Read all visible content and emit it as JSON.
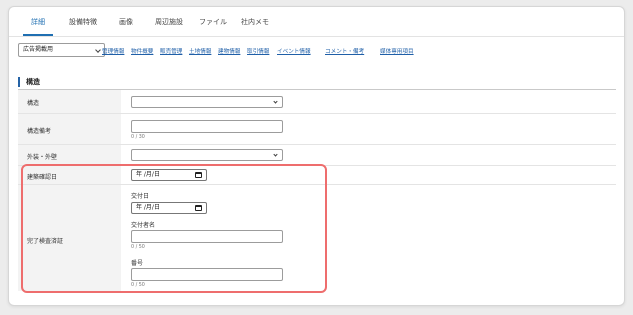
{
  "tabs": [
    {
      "label": "詳細",
      "active": true
    },
    {
      "label": "設備特徴",
      "active": false
    },
    {
      "label": "画像",
      "active": false
    },
    {
      "label": "周辺施設",
      "active": false
    },
    {
      "label": "ファイル",
      "active": false
    },
    {
      "label": "社内メモ",
      "active": false
    }
  ],
  "ad_select": {
    "value": "広告掲載用"
  },
  "jump_links": [
    "管理情報",
    "物件概要",
    "販売管理",
    "土地情報",
    "建物情報",
    "取引情報",
    "イベント情報",
    "コメント・備考",
    "媒体専用項目"
  ],
  "section": {
    "title": "構造"
  },
  "fields": {
    "structure": {
      "label": "構造",
      "value": ""
    },
    "structure_note": {
      "label": "構造備考",
      "value": "",
      "counter": "0 / 30"
    },
    "exterior": {
      "label": "外装・外壁",
      "value": ""
    },
    "confirmation_date": {
      "label": "建築確認日",
      "placeholder": "年 /月/日"
    },
    "inspection": {
      "label": "完了検査済証",
      "delivery_date_label": "交付日",
      "delivery_date_placeholder": "年 /月/日",
      "issuer_label": "交付者名",
      "issuer_counter": "0 / 50",
      "number_label": "番号",
      "number_counter": "0 / 50"
    }
  },
  "colors": {
    "accent": "#1f6fb2",
    "link": "#1f5fa8",
    "highlight": "#ee6d6d",
    "label_bg": "#f3f3f3"
  }
}
